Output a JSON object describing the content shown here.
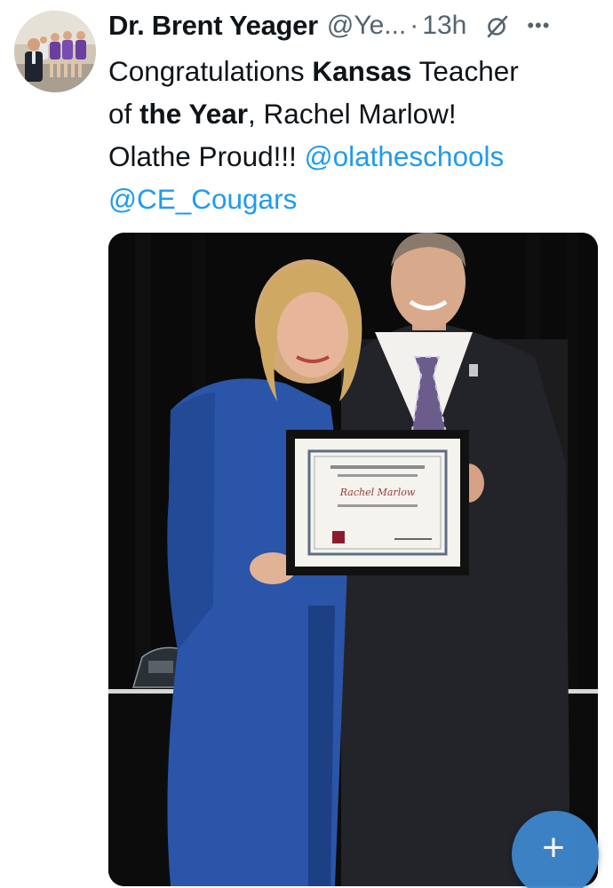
{
  "author": {
    "display_name": "Dr. Brent Yeager",
    "handle": "@Ye...",
    "separator": "·",
    "time": "13h"
  },
  "icons": {
    "grok": "grok-icon",
    "more": "more-options-icon",
    "compose": "plus-icon"
  },
  "tweet": {
    "t1": "Congratulations ",
    "t2": "Kansas",
    "t3": " Teacher",
    "t4": "of ",
    "t5": "the Year",
    "t6": ", Rachel Marlow!",
    "t7": "Olathe Proud!!! ",
    "mention1": "@olatheschools",
    "mention2": "@CE_Cougars"
  },
  "certificate": {
    "name": "Rachel Marlow"
  },
  "colors": {
    "text": "#0f1419",
    "secondary": "#536471",
    "link": "#1d9bf0",
    "fab": "#3d87cc"
  }
}
